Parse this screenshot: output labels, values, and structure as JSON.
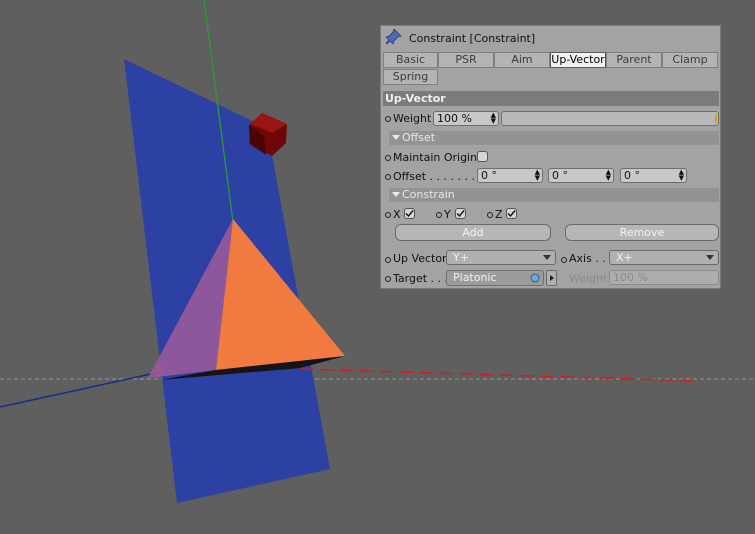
{
  "panel": {
    "title": "Constraint [Constraint]",
    "tabs": [
      {
        "label": "Basic"
      },
      {
        "label": "PSR"
      },
      {
        "label": "Aim"
      },
      {
        "label": "Up-Vector"
      },
      {
        "label": "Parent"
      },
      {
        "label": "Clamp"
      },
      {
        "label": "Spring"
      }
    ],
    "active_tab": "Up-Vector",
    "section_title": "Up-Vector",
    "weight": {
      "label": "Weight",
      "value": "100 %"
    },
    "offset_group": {
      "title": "Offset",
      "maintain_original_label": "Maintain Original",
      "offset_label": "Offset . . . . . . . . .",
      "offset_values": [
        "0 °",
        "0 °",
        "0 °"
      ]
    },
    "constrain_group": {
      "title": "Constrain",
      "axes": [
        {
          "label": "X",
          "checked": true
        },
        {
          "label": "Y",
          "checked": true
        },
        {
          "label": "Z",
          "checked": true
        }
      ],
      "add_label": "Add",
      "remove_label": "Remove"
    },
    "up_vector": {
      "label": "Up Vector",
      "value": "Y+"
    },
    "axis": {
      "label": "Axis . . .",
      "value": "X+"
    },
    "target": {
      "label": "Target . . .",
      "value": "Platonic"
    },
    "target_weight": {
      "label": "Weight",
      "value": "100 %"
    }
  },
  "colors": {
    "background": "#5f5f5f",
    "plane": "#2a3ea8",
    "pyramid": "#f07a40",
    "cube": "#8c0c0c",
    "y_axis": "#2da02d",
    "x_axis": "#cc2020",
    "z_axis": "#1a2a8a",
    "panel": "#a3a3a3"
  }
}
